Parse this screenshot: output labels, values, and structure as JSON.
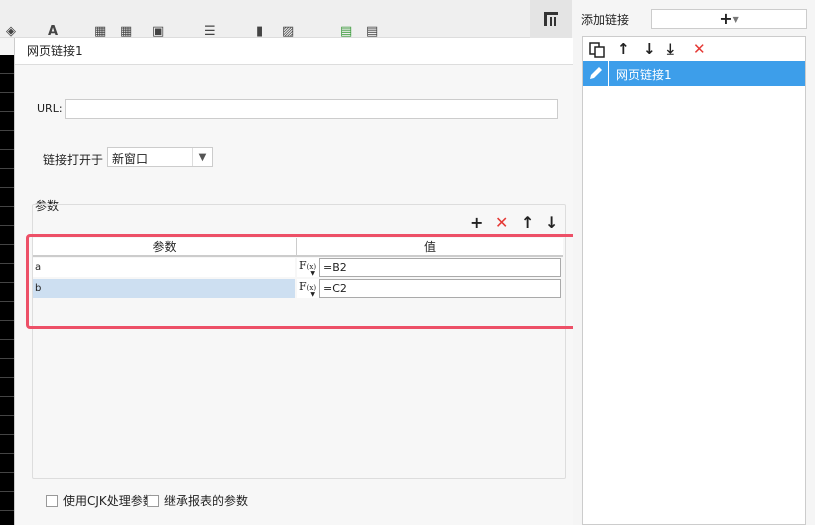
{
  "dialog": {
    "title": "网页链接1",
    "url_label": "URL:",
    "url_value": "",
    "open_in_label": "链接打开于",
    "open_in_value": "新窗口",
    "params_label": "参数",
    "table_headers": [
      "参数",
      "值"
    ],
    "rows": [
      {
        "name": "a",
        "fx": "F",
        "fx_sub": "(x)",
        "value": "=B2",
        "selected": false
      },
      {
        "name": "b",
        "fx": "F",
        "fx_sub": "(x)",
        "value": "=C2",
        "selected": true
      }
    ],
    "checkbox_cjk": "使用CJK处理参数",
    "checkbox_inherit": "继承报表的参数"
  },
  "right_panel": {
    "add_link_label": "添加链接",
    "add_link_button": "+",
    "links": [
      {
        "label": "网页链接1",
        "selected": true
      }
    ]
  },
  "colors": {
    "accent_blue": "#3d9eea",
    "selected_row": "#cddff1",
    "delete_red": "#e53935",
    "highlight_box": "#ed5067"
  },
  "icons": {
    "param_toolbar": [
      "plus-icon",
      "close-icon",
      "arrow-up-icon",
      "arrow-down-icon"
    ],
    "link_toolbar": [
      "copy-icon",
      "arrow-up-icon",
      "arrow-down-icon",
      "move-bottom-icon",
      "close-icon"
    ]
  }
}
